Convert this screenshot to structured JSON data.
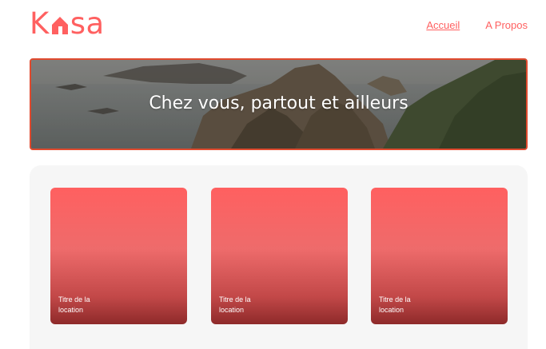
{
  "header": {
    "logo_text_left": "K",
    "logo_text_right": "sa",
    "logo_icon": "house-icon",
    "nav": [
      {
        "label": "Accueil",
        "active": true
      },
      {
        "label": "A Propos",
        "active": false
      }
    ]
  },
  "banner": {
    "title": "Chez vous, partout et ailleurs"
  },
  "gallery": {
    "cards": [
      {
        "title": "Titre de la location"
      },
      {
        "title": "Titre de la location"
      },
      {
        "title": "Titre de la location"
      }
    ]
  },
  "colors": {
    "brand": "#FF6060",
    "banner_border": "#E04A2E",
    "gallery_bg": "#F6F6F6"
  }
}
